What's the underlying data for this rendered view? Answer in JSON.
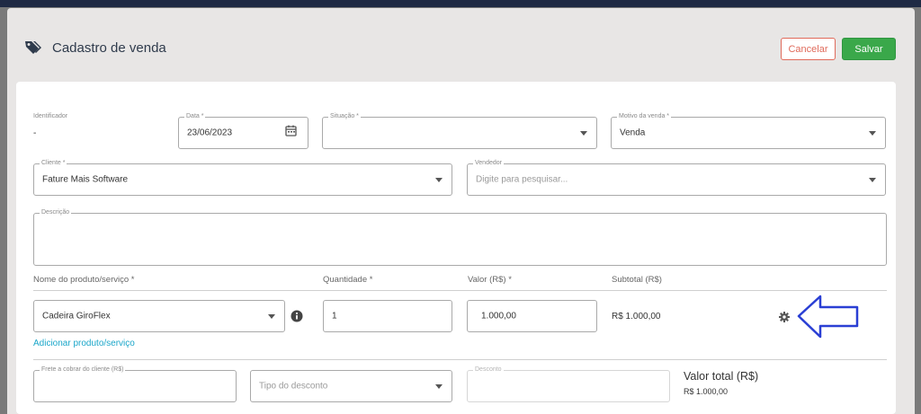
{
  "modal": {
    "title": "Cadastro de venda",
    "cancel_label": "Cancelar",
    "save_label": "Salvar"
  },
  "form": {
    "identificador": {
      "label": "Identificador",
      "value": "-"
    },
    "data": {
      "label": "Data *",
      "value": "23/06/2023"
    },
    "situacao": {
      "label": "Situação *",
      "value": ""
    },
    "motivo": {
      "label": "Motivo da venda *",
      "value": "Venda"
    },
    "cliente": {
      "label": "Cliente *",
      "value": "Fature Mais Software"
    },
    "vendedor": {
      "label": "Vendedor",
      "placeholder": "Digite para pesquisar..."
    },
    "descricao": {
      "label": "Descrição",
      "value": ""
    }
  },
  "items": {
    "headers": {
      "produto": "Nome do produto/serviço *",
      "quantidade": "Quantidade *",
      "valor": "Valor (R$) *",
      "subtotal": "Subtotal (R$)"
    },
    "rows": [
      {
        "produto": "Cadeira GiroFlex",
        "quantidade": "1",
        "valor": "1.000,00",
        "subtotal": "R$ 1.000,00"
      }
    ],
    "add_link": "Adicionar produto/serviço"
  },
  "footer": {
    "frete": {
      "label": "Frete a cobrar do cliente (R$)",
      "value": ""
    },
    "tipo_desconto": {
      "placeholder": "Tipo do desconto"
    },
    "desconto": {
      "label": "Desconto",
      "value": ""
    },
    "total_label": "Valor total (R$)",
    "total_value": "R$ 1.000,00"
  },
  "colors": {
    "accent_save": "#3aa84a",
    "cancel": "#e06a5a",
    "link": "#1aa6c9",
    "annotation_arrow": "#2a3fd4"
  },
  "icons": [
    "tag-icon",
    "calendar-icon",
    "chevron-down-icon",
    "info-icon",
    "gear-icon",
    "arrow-left-icon"
  ]
}
